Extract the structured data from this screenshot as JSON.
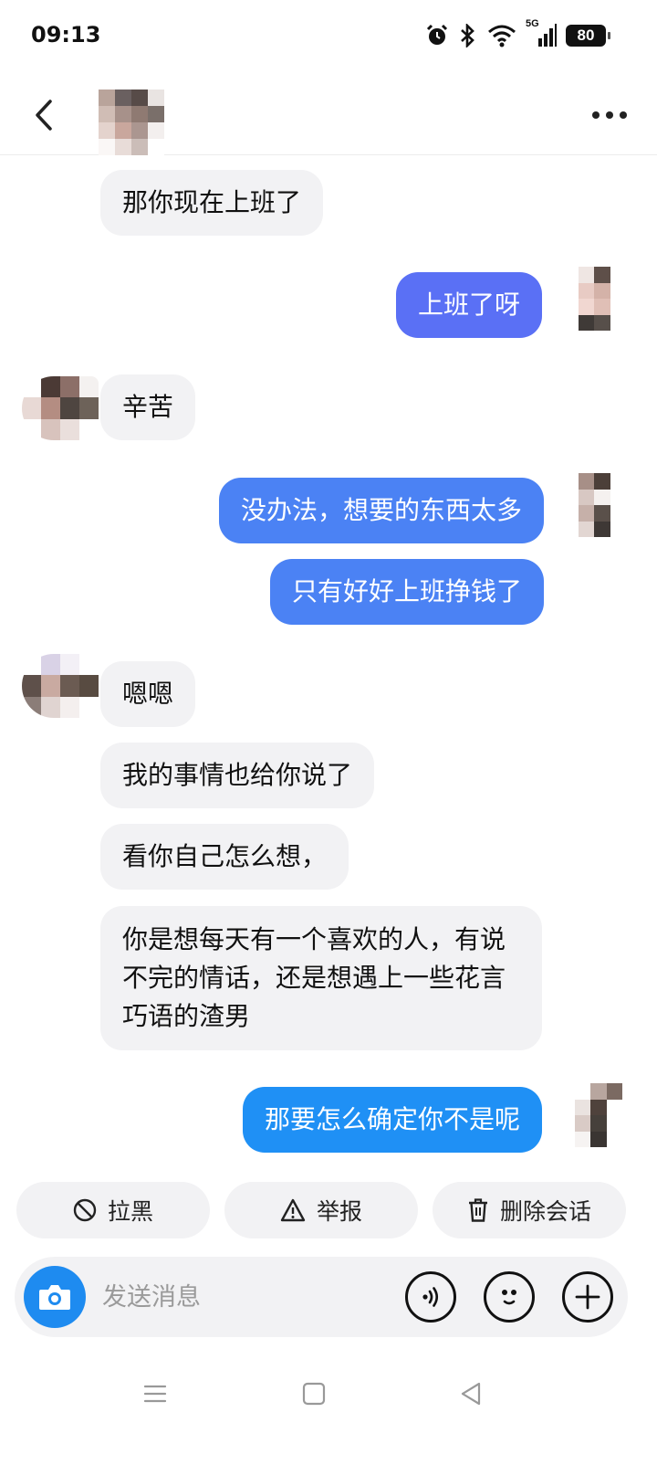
{
  "status_bar": {
    "time": "09:13",
    "network": "5G",
    "battery": "80"
  },
  "header": {
    "contact_name": "",
    "icons": [
      "back-icon",
      "more-icon"
    ]
  },
  "messages": [
    {
      "side": "in",
      "text": "那你现在上班了"
    },
    {
      "side": "out",
      "text": "上班了呀",
      "color": "#5a70f5"
    },
    {
      "side": "in",
      "text": "辛苦"
    },
    {
      "side": "out",
      "text": "没办法，想要的东西太多",
      "color": "#4b82f4"
    },
    {
      "side": "out",
      "text": "只有好好上班挣钱了",
      "color": "#4b82f4"
    },
    {
      "side": "in",
      "text": "嗯嗯"
    },
    {
      "side": "in",
      "text": "我的事情也给你说了"
    },
    {
      "side": "in",
      "text": "看你自己怎么想，"
    },
    {
      "side": "in",
      "text": "你是想每天有一个喜欢的人，有说不完的情话，还是想遇上一些花言巧语的渣男"
    },
    {
      "side": "out",
      "text": "那要怎么确定你不是呢",
      "color": "#1f90f5"
    }
  ],
  "actions": {
    "block": "拉黑",
    "report": "举报",
    "delete": "删除会话"
  },
  "input": {
    "placeholder": "发送消息"
  },
  "colors": {
    "incoming_bubble": "#f2f2f4",
    "camera_button": "#1e8bf0"
  }
}
